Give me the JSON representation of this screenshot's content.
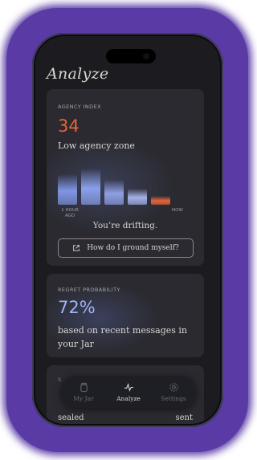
{
  "page": {
    "title": "Analyze"
  },
  "agency": {
    "label": "AGENCY INDEX",
    "value": "34",
    "zone": "Low agency zone",
    "bars": [
      {
        "level": 0.75,
        "color": "#7f96e4"
      },
      {
        "level": 0.9,
        "color": "#8aa0ea"
      },
      {
        "level": 0.62,
        "color": "#8e9fe4"
      },
      {
        "level": 0.4,
        "color": "#a4b1e6"
      },
      {
        "level": 0.22,
        "color": "#e8643a"
      }
    ],
    "axis_start": "1 HOUR\nAGO",
    "axis_end": "NOW",
    "status": "You’re drifting.",
    "ground_button": "How do I ground myself?"
  },
  "regret": {
    "label": "REGRET PROBABILITY",
    "value": "72%",
    "description": "based on recent messages in your Jar"
  },
  "partial_card": {
    "label": "S",
    "left_word": "sealed",
    "right_word": "sent"
  },
  "tabs": [
    {
      "label": "My Jar",
      "icon": "jar-icon",
      "active": false
    },
    {
      "label": "Analyze",
      "icon": "pulse-icon",
      "active": true
    },
    {
      "label": "Settings",
      "icon": "gear-icon",
      "active": false
    }
  ],
  "colors": {
    "accent_orange": "#e8643a",
    "accent_blue": "#9fb3f4",
    "frame_glow": "#5a3ba6"
  }
}
